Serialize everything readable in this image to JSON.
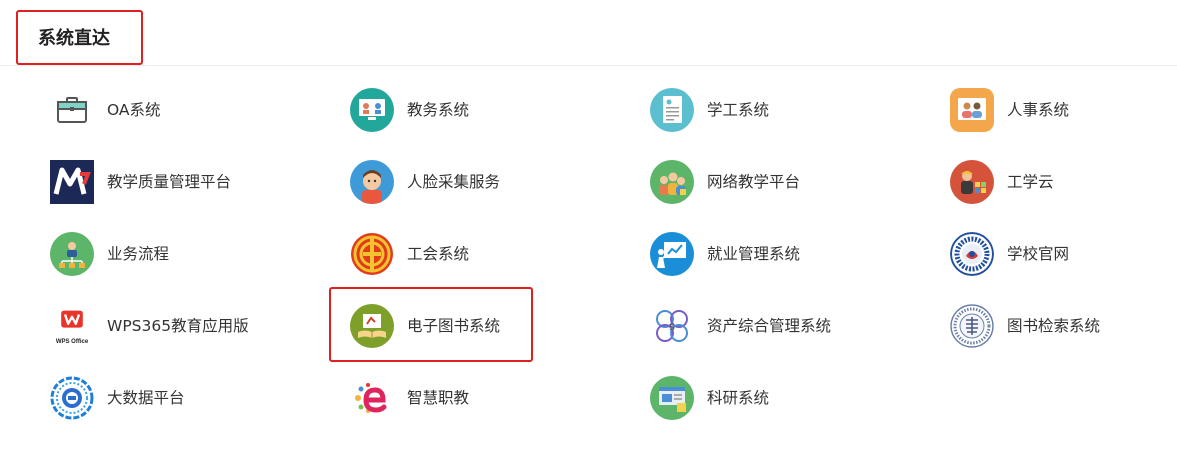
{
  "section": {
    "title": "系统直达"
  },
  "systems": [
    {
      "label": "OA系统",
      "icon": "briefcase-icon"
    },
    {
      "label": "教务系统",
      "icon": "classroom-monitor-icon"
    },
    {
      "label": "学工系统",
      "icon": "document-icon"
    },
    {
      "label": "人事系统",
      "icon": "people-screen-icon"
    },
    {
      "label": "教学质量管理平台",
      "icon": "my-logo-icon"
    },
    {
      "label": "人脸采集服务",
      "icon": "face-avatar-icon"
    },
    {
      "label": "网络教学平台",
      "icon": "students-icon"
    },
    {
      "label": "工学云",
      "icon": "worker-cloud-icon"
    },
    {
      "label": "业务流程",
      "icon": "workflow-icon"
    },
    {
      "label": "工会系统",
      "icon": "union-emblem-icon"
    },
    {
      "label": "就业管理系统",
      "icon": "presentation-icon"
    },
    {
      "label": "学校官网",
      "icon": "school-seal-icon"
    },
    {
      "label": "WPS365教育应用版",
      "icon": "wps-office-icon",
      "icon_text": "WPS Office"
    },
    {
      "label": "电子图书系统",
      "icon": "ebook-icon"
    },
    {
      "label": "资产综合管理系统",
      "icon": "asset-management-icon"
    },
    {
      "label": "图书检索系统",
      "icon": "library-seal-icon"
    },
    {
      "label": "大数据平台",
      "icon": "big-data-ring-icon"
    },
    {
      "label": "智慧职教",
      "icon": "smart-education-icon"
    },
    {
      "label": "科研系统",
      "icon": "research-screen-icon"
    }
  ],
  "highlighted": [
    "系统直达",
    "电子图书系统"
  ],
  "colors": {
    "highlight": "#e02020",
    "divider": "#ececec",
    "text": "#333333"
  }
}
